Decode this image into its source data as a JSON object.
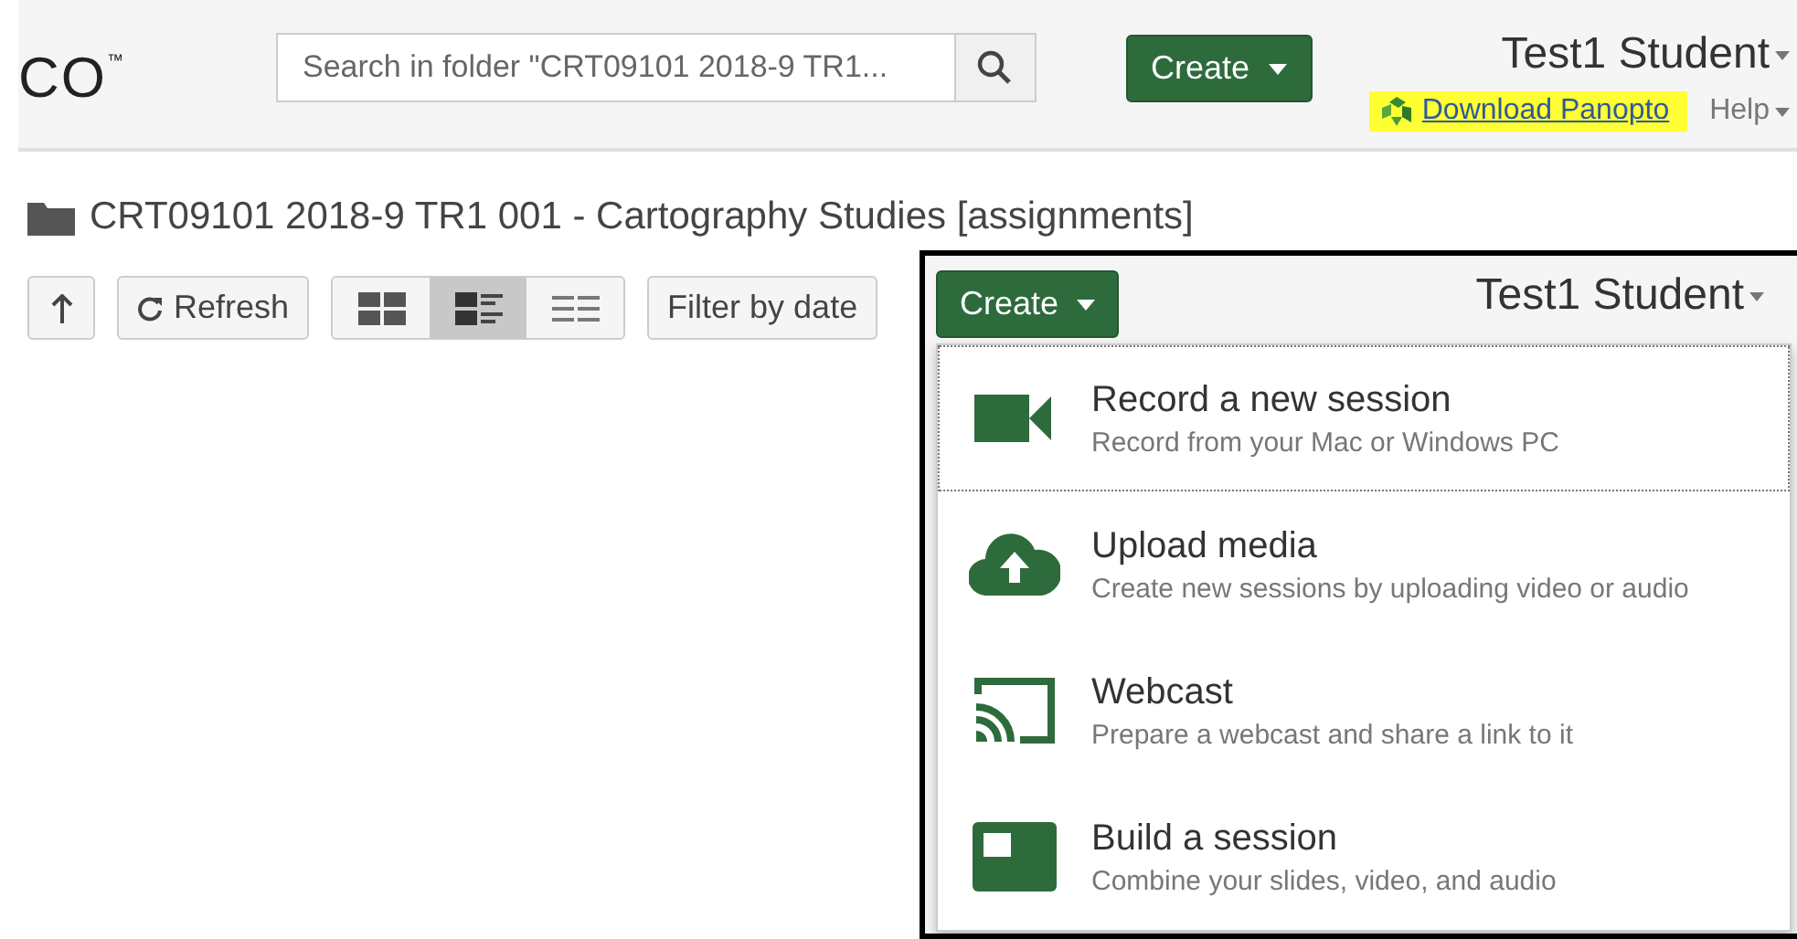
{
  "header": {
    "logo": "CO",
    "logo_mark": "™",
    "search": {
      "placeholder": "Search in folder \"CRT09101 2018-9 TR1..."
    },
    "create_button": "Create",
    "user_name": "Test1 Student",
    "download_link": "Download Panopto",
    "help": "Help"
  },
  "folder": {
    "title": "CRT09101 2018-9 TR1 001 - Cartography Studies [assignments]"
  },
  "toolbar": {
    "refresh": "Refresh",
    "views": [
      {
        "kind": "thumbnails",
        "selected": false
      },
      {
        "kind": "detailed",
        "selected": true
      },
      {
        "kind": "list",
        "selected": false
      }
    ],
    "filter": "Filter by date"
  },
  "inset": {
    "create_button": "Create",
    "user_name": "Test1 Student",
    "menu": [
      {
        "title": "Record a new session",
        "subtitle": "Record from your Mac or Windows PC",
        "focused": true
      },
      {
        "title": "Upload media",
        "subtitle": "Create new sessions by uploading video or audio",
        "focused": false
      },
      {
        "title": "Webcast",
        "subtitle": "Prepare a webcast and share a link to it",
        "focused": false
      },
      {
        "title": "Build a session",
        "subtitle": "Combine your slides, video, and audio",
        "focused": false
      }
    ]
  }
}
